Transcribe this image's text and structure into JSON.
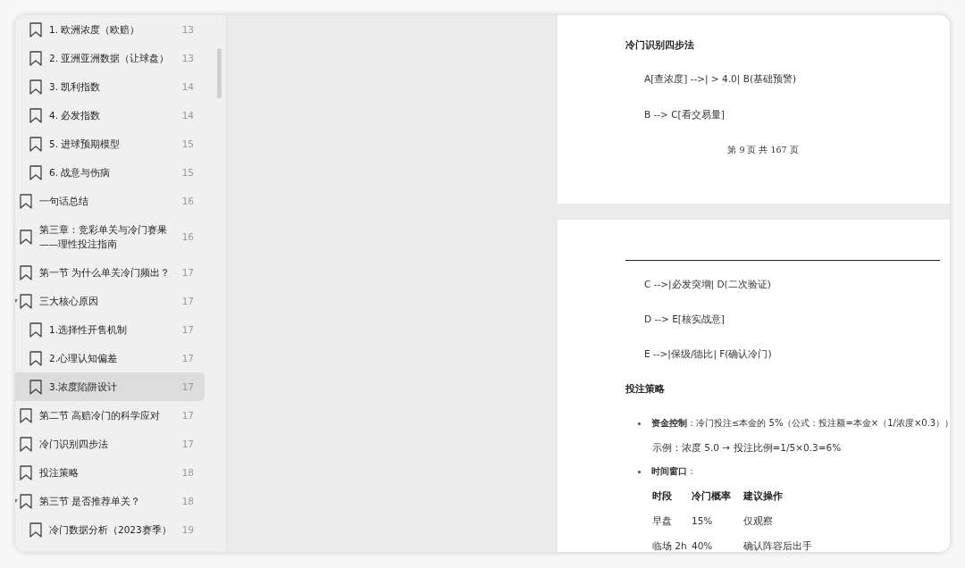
{
  "outline": [
    {
      "children": [
        {
          "label": "1. 欧洲浓度（欧赔）",
          "page": "13",
          "selected": false
        },
        {
          "label": "2. 亚洲亚洲数据（让球盘）",
          "page": "13",
          "selected": false
        },
        {
          "label": "3. 凯利指数",
          "page": "14",
          "selected": false
        },
        {
          "label": "4. 必发指数",
          "page": "14",
          "selected": false
        },
        {
          "label": "5. 进球预期模型",
          "page": "15",
          "selected": false
        },
        {
          "label": "6. 战意与伤病",
          "page": "15",
          "selected": false
        }
      ]
    },
    {
      "label": "一句话总结",
      "page": "16",
      "selected": false
    },
    {
      "label": "第三章：竞彩单关与冷门赛果——理性投注指南",
      "page": "16",
      "selected": false
    },
    {
      "label": "第一节 为什么单关冷门频出？",
      "page": "17",
      "selected": false
    },
    {
      "label": "三大核心原因",
      "page": "17",
      "selected": false,
      "expanded": true,
      "children": [
        {
          "label": "1.选择性开售机制",
          "page": "17",
          "selected": false
        },
        {
          "label": "2.心理认知偏差",
          "page": "17",
          "selected": false
        },
        {
          "label": "3.浓度陷阱设计",
          "page": "17",
          "selected": true
        }
      ]
    },
    {
      "label": "第二节 高赔冷门的科学应对",
      "page": "17",
      "selected": false
    },
    {
      "label": "冷门识别四步法",
      "page": "17",
      "selected": false
    },
    {
      "label": "投注策略",
      "page": "18",
      "selected": false
    },
    {
      "label": "第三节 是否推荐单关？",
      "page": "18",
      "selected": false,
      "expanded": true,
      "children": [
        {
          "label": "冷门数据分析（2023赛季）",
          "page": "19",
          "selected": false
        }
      ]
    }
  ],
  "pages": [
    {
      "blocks": [
        {
          "kind": "heading",
          "text": "冷门识别四步法"
        },
        {
          "kind": "line",
          "text": "A[查浓度] -->| > 4.0| B(基础预警)"
        },
        {
          "kind": "line",
          "text": "B --> C[看交易量]"
        },
        {
          "kind": "footer",
          "text": "第 9 页 共 167 页"
        }
      ]
    },
    {
      "blocks": [
        {
          "kind": "rule"
        },
        {
          "kind": "line",
          "text": "C -->|必发突增| D(二次验证)"
        },
        {
          "kind": "line",
          "text": "D --> E[核实战意]"
        },
        {
          "kind": "line",
          "text": "E -->|保级/德比| F(确认冷门)"
        },
        {
          "kind": "heading",
          "text": "投注策略"
        },
        {
          "kind": "bullet",
          "text": "**资金控制**：冷门投注≤本金的 5%（公式：投注额=本金×（1/浓度×0.3））"
        },
        {
          "kind": "note",
          "text": "示例：浓度 5.0 → 投注比例=1/5×0.3=6%"
        },
        {
          "kind": "bullet",
          "text": "**时间窗口**："
        },
        {
          "kind": "table",
          "columns": [
            "时段",
            "冷门概率",
            "建议操作"
          ],
          "rows": [
            [
              "早盘",
              "15%",
              "仅观察"
            ],
            [
              "临场 2h",
              "40%",
              "确认阵容后出手"
            ]
          ]
        }
      ]
    }
  ]
}
